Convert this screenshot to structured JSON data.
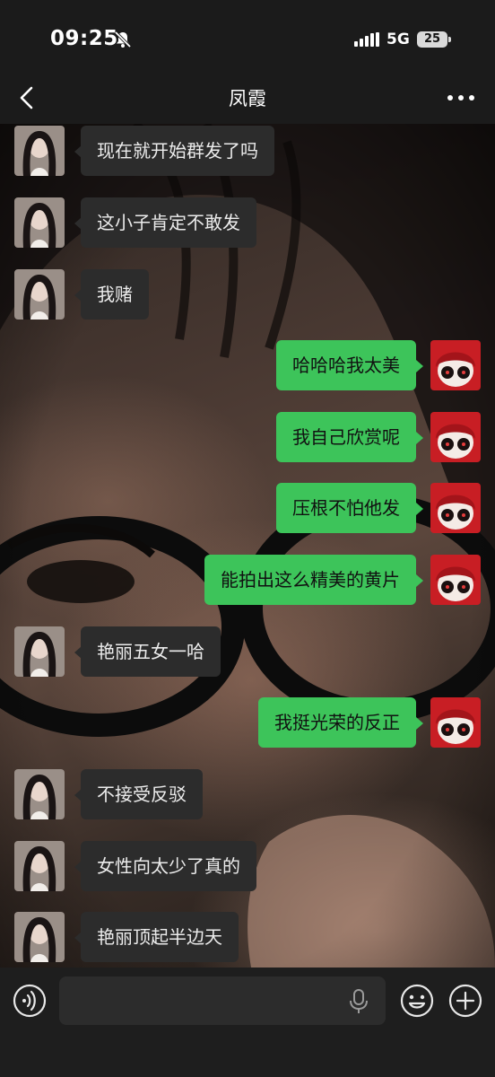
{
  "status_bar": {
    "time": "09:25",
    "network": "5G",
    "battery": "25"
  },
  "nav": {
    "title": "凤霞"
  },
  "messages": [
    {
      "side": "in",
      "text": "现在就开始群发了吗"
    },
    {
      "side": "in",
      "text": "这小子肯定不敢发"
    },
    {
      "side": "in",
      "text": "我赌"
    },
    {
      "side": "out",
      "text": "哈哈哈我太美"
    },
    {
      "side": "out",
      "text": "我自己欣赏呢"
    },
    {
      "side": "out",
      "text": "压根不怕他发"
    },
    {
      "side": "out",
      "text": "能拍出这么精美的黄片"
    },
    {
      "side": "in",
      "text": "艳丽五女一哈"
    },
    {
      "side": "out",
      "text": "我挺光荣的反正"
    },
    {
      "side": "in",
      "text": "不接受反驳"
    },
    {
      "side": "in",
      "text": "女性向太少了真的"
    },
    {
      "side": "in",
      "text": "艳丽顶起半边天"
    }
  ],
  "input": {
    "value": ""
  },
  "colors": {
    "outgoing_bubble": "#3dc45a",
    "incoming_bubble": "#2c2c2c",
    "bar_background": "#1b1b1b"
  },
  "icons": [
    "back-icon",
    "more-icon",
    "voice-icon",
    "mic-icon",
    "emoji-icon",
    "plus-icon",
    "bell-off-icon",
    "signal-icon",
    "battery-icon"
  ]
}
